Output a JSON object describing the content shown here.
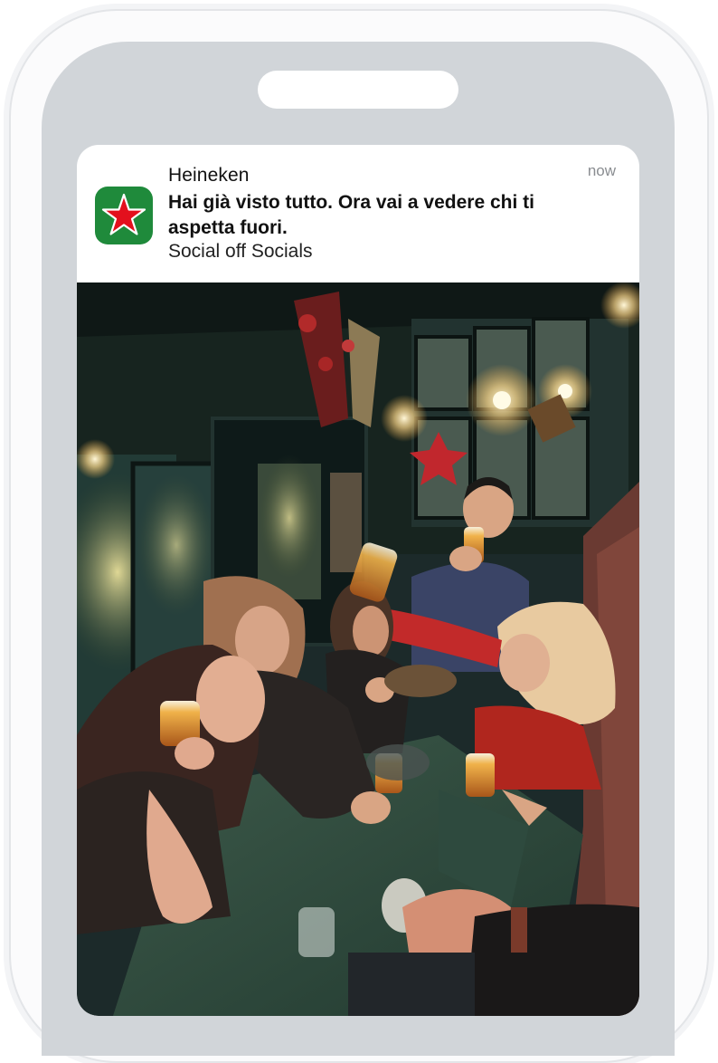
{
  "notification": {
    "app_name": "Heineken",
    "time": "now",
    "title": "Hai già visto tutto. Ora vai a vedere chi ti aspetta fuori.",
    "body": "Social off Socials",
    "app_icon": "heineken-star-icon",
    "media": "photo-friends-toasting-in-pub"
  },
  "colors": {
    "icon_bg": "#1f8a3b",
    "icon_star": "#e3101d",
    "screen_bg": "#d1d5d9"
  }
}
